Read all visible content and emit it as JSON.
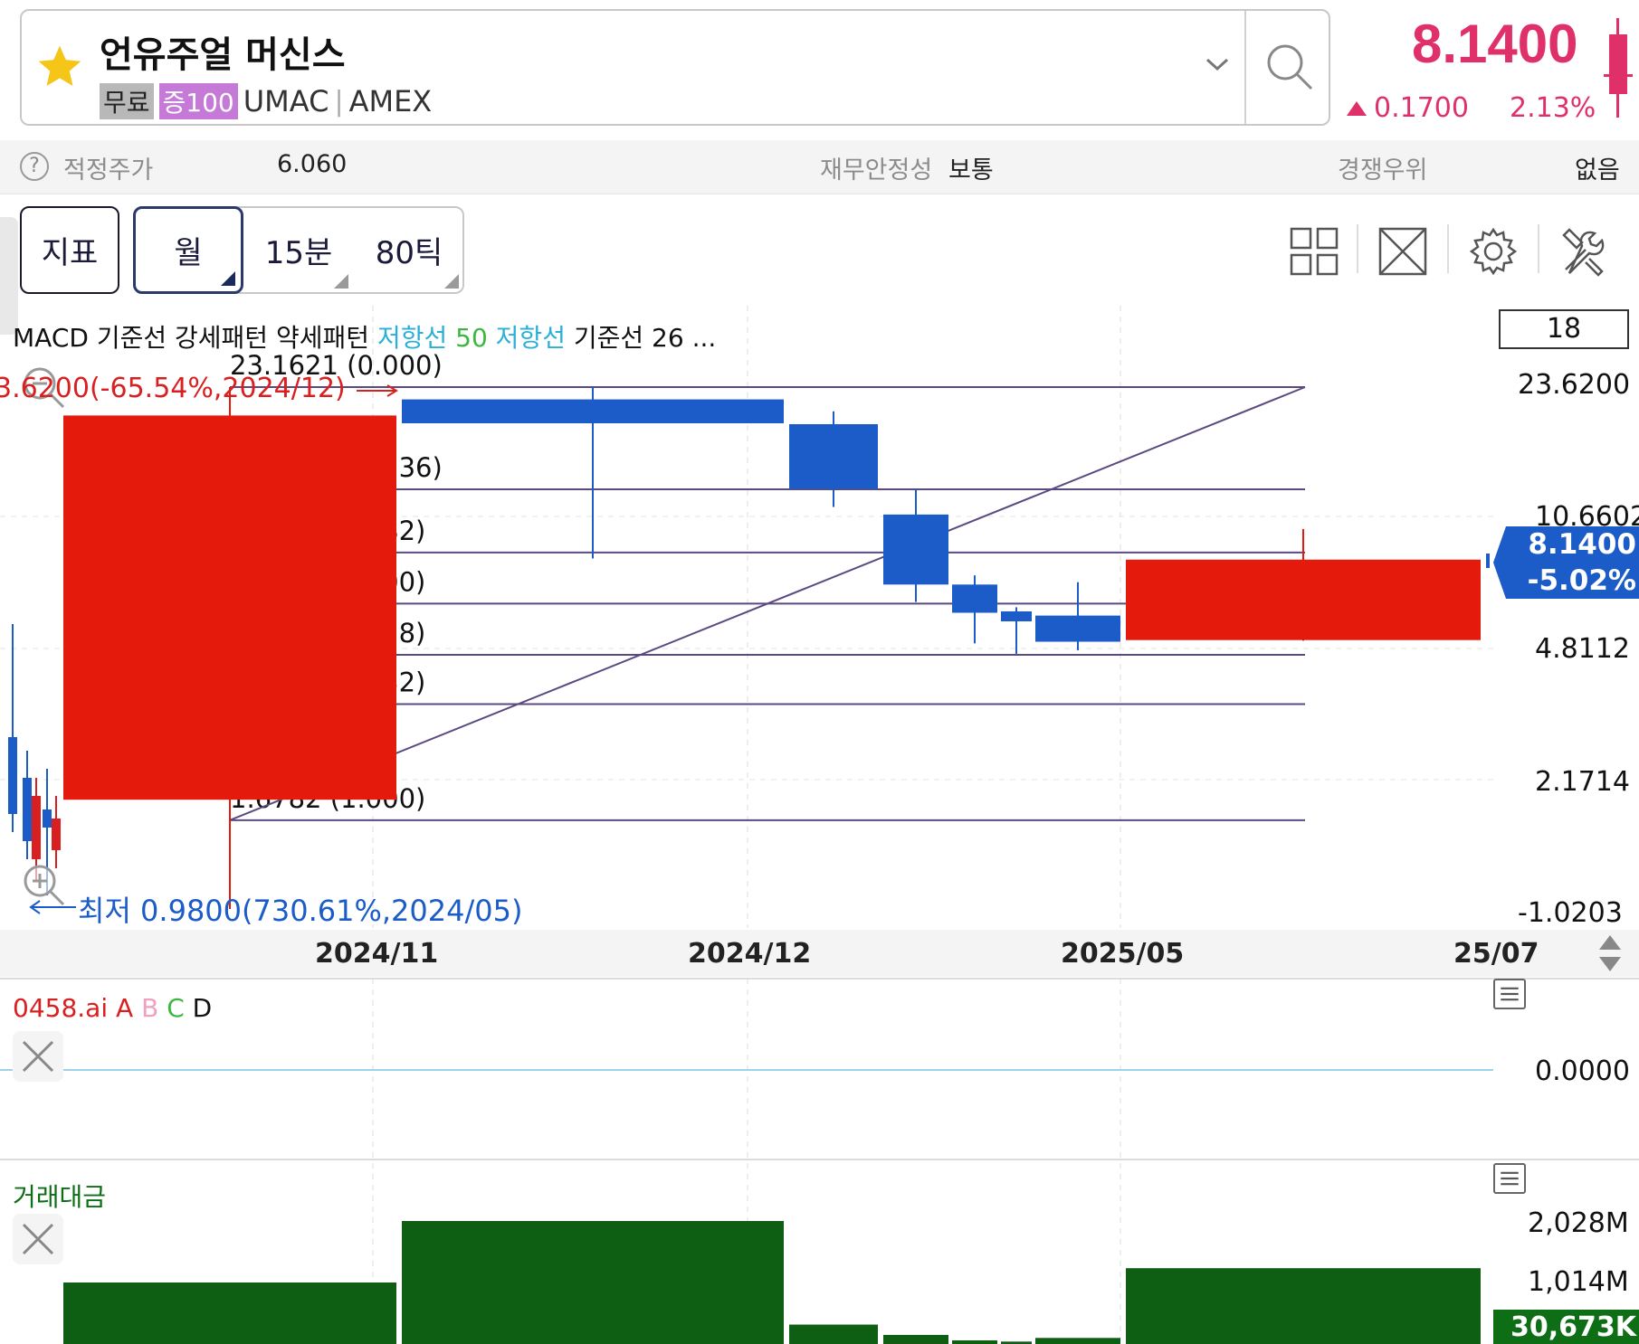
{
  "header": {
    "stock_name": "언유주얼 머신스",
    "tag_free": "무료",
    "tag_margin": "증100",
    "ticker": "UMAC",
    "separator": "|",
    "exchange": "AMEX",
    "price": "8.1400",
    "change_value": "0.1700",
    "change_pct": "2.13%",
    "accent_color": "#e0306a"
  },
  "info": {
    "fair_price_label": "적정주가",
    "fair_price_value": "6.060",
    "financial_label": "재무안정성",
    "financial_value": "보통",
    "competitive_label": "경쟁우위",
    "competitive_value": "없음"
  },
  "toolbar": {
    "indicator_label": "지표",
    "period_month": "월",
    "period_15m": "15분",
    "period_80t": "80틱",
    "icons": [
      "grid-layout-icon",
      "expand-icon",
      "gear-icon",
      "tools-icon"
    ]
  },
  "chart": {
    "legend": {
      "macd": "MACD",
      "base1": "기준선",
      "strong": "강세패턴",
      "weak": "약세패턴",
      "support1": "저항선",
      "n50": "50",
      "support2": "저항선",
      "base2": "기준선",
      "n26": "26",
      "ellipsis": "..."
    },
    "period_box": "18",
    "high_note": "3.6200(-65.54%,2024/12)",
    "low_note": "최저 0.9800(730.61%,2024/05)",
    "price_axis": [
      "23.6200",
      "10.6602",
      "4.8112",
      "2.1714",
      "-1.0203"
    ],
    "current_price": "8.1400",
    "current_pct": "-5.02%",
    "x_labels": [
      "2024/11",
      "2024/12",
      "2025/05",
      "25/07"
    ],
    "fib_levels": [
      {
        "text": "23.1621 (0.000)"
      },
      {
        "text": "12.4667 (0.236)"
      },
      {
        "text": "8.4981 (0.382)"
      },
      {
        "text": "6.2346 (0.500)"
      },
      {
        "text": "4.5740 (0.618)"
      },
      {
        "text": "3.3911 (0.732)"
      },
      {
        "text": "1.6782 (1.000)"
      }
    ]
  },
  "sub1": {
    "legend_name": "0458.ai",
    "legend_a": "A",
    "legend_b": "B",
    "legend_c": "C",
    "legend_d": "D",
    "zero_label": "0.0000"
  },
  "sub2": {
    "legend": "거래대금",
    "axis_top": "2,028M",
    "axis_mid": "1,014M",
    "current": "30,673K"
  },
  "chart_data": {
    "type": "candlestick",
    "title": "",
    "xlabel": "",
    "ylabel": "",
    "log_scale": true,
    "grid": true,
    "candles": [
      {
        "label": "2024/11",
        "open": 1.9,
        "high": 23.1621,
        "low": 0.98,
        "close": 19.5,
        "color": "red"
      },
      {
        "label": "2024/12",
        "open": 21.5,
        "high": 23.1621,
        "low": 8.2,
        "close": 18.6,
        "color": "blue"
      },
      {
        "label": "",
        "open": 18.5,
        "high": 20.0,
        "low": 11.2,
        "close": 12.5,
        "color": "blue"
      },
      {
        "label": "",
        "open": 10.7,
        "high": 12.5,
        "low": 6.3,
        "close": 7.0,
        "color": "blue"
      },
      {
        "label": "",
        "open": 7.0,
        "high": 7.4,
        "low": 4.9,
        "close": 5.9,
        "color": "blue"
      },
      {
        "label": "",
        "open": 5.95,
        "high": 6.1,
        "low": 4.6,
        "close": 5.6,
        "color": "blue"
      },
      {
        "label": "2025/05",
        "open": 5.8,
        "high": 7.1,
        "low": 4.7,
        "close": 4.95,
        "color": "blue"
      },
      {
        "label": "25/07",
        "open": 5.0,
        "high": 9.8,
        "low": 4.98,
        "close": 8.14,
        "color": "red"
      }
    ],
    "volume": [
      1014,
      2028,
      320,
      150,
      60,
      40,
      100,
      1250
    ],
    "volume_unit": "M"
  }
}
